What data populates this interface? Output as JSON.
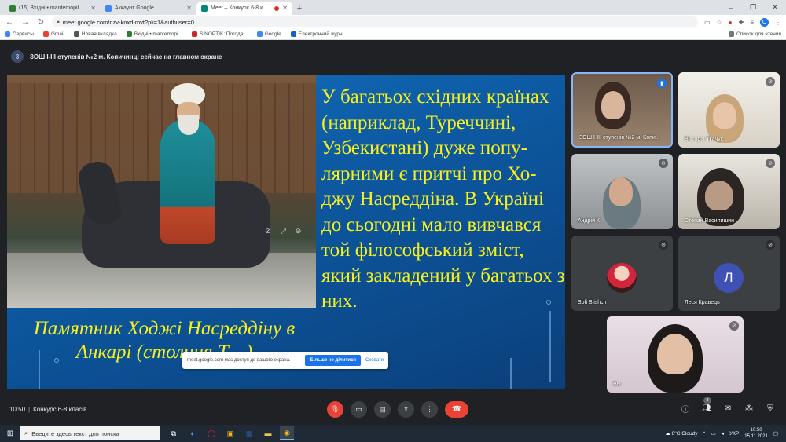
{
  "browser": {
    "tabs": [
      {
        "label": "(15) Вхідні • mantemopil@ukr.ne",
        "color": "#2e7d32",
        "active": false
      },
      {
        "label": "Аккаунт Google",
        "color": "#4285f4",
        "active": false
      },
      {
        "label": "Meet – Конкурс 6-8 класів",
        "color": "#00897b",
        "active": true
      }
    ],
    "new_tab": "+",
    "url": "meet.google.com/nzv-knxd-mvt?pli=1&authuser=0",
    "profile_initial": "O",
    "bookmarks": [
      "Сервисы",
      "Gmail",
      "Новая вкладка",
      "Вхідні • mantemopi...",
      "SINOPTIK: Погода...",
      "Google",
      "Електронний журн..."
    ],
    "reading_list": "Список для чтения"
  },
  "meet": {
    "participant_count_badge": "3",
    "presenting_banner": "ЗОШ I-III ступенів №2 м. Копичинці сейчас на главном экране",
    "slide": {
      "main_text": "У багатьох східних країнах (наприклад, Туреччині, Узбекистані) дуже попу-лярними є притчі про Хо-джу Насреддіна. В Україні до сьогодні мало вивчався той філософський зміст, який закладений у багатьох з них.",
      "caption": "Памятник Ходжі Насреддіну в Анкарі (столиця Т",
      "caption_tail": "…)"
    },
    "share_notice": {
      "message": "meet.google.com має доступ до вашого екрана.",
      "stop_label": "Більше не ділитися",
      "hide_label": "Сховати"
    },
    "participants": [
      {
        "name": "ЗОШ I-III ступенів №2 м. Копи...",
        "speaking": true
      },
      {
        "name": "Вікторія Ткачук",
        "speaking": false
      },
      {
        "name": "Андрій К.",
        "speaking": false
      },
      {
        "name": "Степан Василишин",
        "speaking": false
      },
      {
        "name": "Sofi Blishch",
        "speaking": false
      },
      {
        "name": "Леся Кравець",
        "speaking": false,
        "initial": "Л"
      },
      {
        "name": "Вы",
        "speaking": false
      }
    ],
    "time": "10:50",
    "meeting_title": "Конкурс 6-8 класів",
    "people_count": "8"
  },
  "taskbar": {
    "search_placeholder": "Введите здесь текст для поиска",
    "weather": "6°C  Cloudy",
    "lang": "УКР",
    "clock_time": "10:50",
    "clock_date": "15.11.2021"
  },
  "colors": {
    "slide_text": "#f5f01e",
    "slide_bg": "#1572c2",
    "end_call": "#ea4335",
    "accent": "#1a73e8"
  }
}
